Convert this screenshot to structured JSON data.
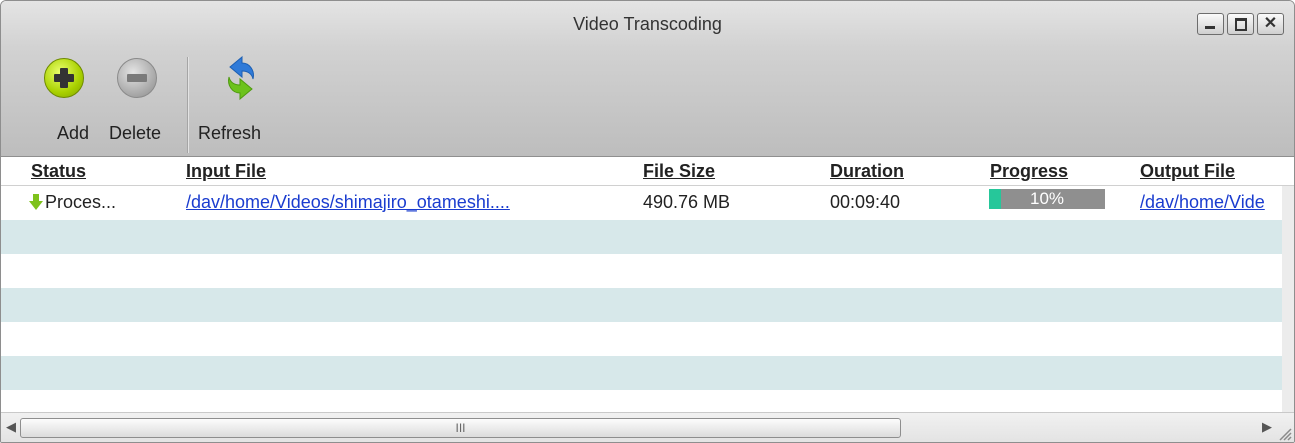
{
  "window": {
    "title": "Video Transcoding"
  },
  "toolbar": {
    "add_label": "Add",
    "delete_label": "Delete",
    "refresh_label": "Refresh"
  },
  "columns": [
    "Status",
    "Input File",
    "File Size",
    "Duration",
    "Progress",
    "Output File"
  ],
  "rows": [
    {
      "status": "Proces...",
      "input_file": "/dav/home/Videos/shimajiro_otameshi....",
      "file_size": "490.76 MB",
      "duration": "00:09:40",
      "progress_text": "10%",
      "progress": 0.1,
      "output_file": "/dav/home/Vide"
    }
  ],
  "scrollbar": {
    "grip": "III"
  },
  "colors": {
    "progress_fill": "#26c79a",
    "progress_track": "#8f8f8f",
    "row_alt": "#d7e8ea",
    "link": "#1a3ccf"
  },
  "icons": [
    "add-icon",
    "delete-icon",
    "refresh-icon",
    "status-arrow-down-icon",
    "minimize-icon",
    "maximize-icon",
    "close-icon"
  ]
}
